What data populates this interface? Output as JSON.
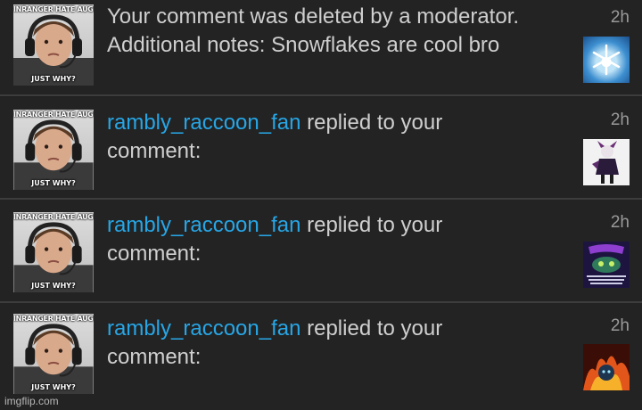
{
  "notifications": [
    {
      "avatar_top_caption": "INRANGER HATE AUGUSTE",
      "avatar_bottom_caption": "JUST WHY?",
      "message_line1": "Your comment was deleted by a moderator.",
      "message_line2": "Additional notes: Snowflakes are cool bro",
      "time": "2h",
      "thumbnail": "snowflake-thumbnail"
    },
    {
      "avatar_top_caption": "INRANGER HATE AUGUSTE",
      "avatar_bottom_caption": "JUST WHY?",
      "username": "rambly_raccoon_fan",
      "action": " replied to your",
      "message_line2": "comment:",
      "time": "2h",
      "thumbnail": "character-thumbnail"
    },
    {
      "avatar_top_caption": "INRANGER HATE AUGUSTE",
      "avatar_bottom_caption": "JUST WHY?",
      "username": "rambly_raccoon_fan",
      "action": " replied to your",
      "message_line2": "comment:",
      "time": "2h",
      "thumbnail": "meme-thumbnail"
    },
    {
      "avatar_top_caption": "INRANGER HATE AUGUSTE",
      "avatar_bottom_caption": "JUST WHY?",
      "username": "rambly_raccoon_fan",
      "action": " replied to your",
      "message_line2": "comment:",
      "time": "2h",
      "thumbnail": "fire-thumbnail"
    }
  ],
  "watermark": "imgflip.com",
  "colors": {
    "background": "#232323",
    "separator": "#3d3d3d",
    "username": "#27a6e6",
    "text": "#cfcfcf",
    "time": "#9a9a9a"
  }
}
